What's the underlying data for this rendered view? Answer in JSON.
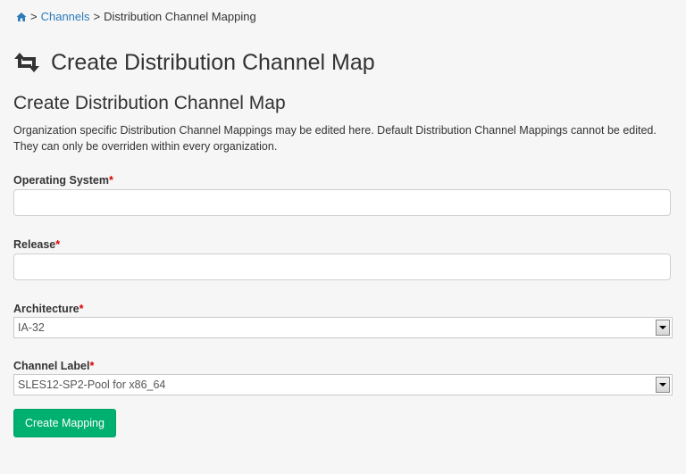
{
  "breadcrumb": {
    "home_icon": "home-icon",
    "sep1": ">",
    "channels": "Channels",
    "sep2": ">",
    "current": "Distribution Channel Mapping"
  },
  "header": {
    "icon": "retweet-icon",
    "title": "Create Distribution Channel Map"
  },
  "form": {
    "section_title": "Create Distribution Channel Map",
    "description": "Organization specific Distribution Channel Mappings may be edited here. Default Distribution Channel Mappings cannot be edited. They can only be overriden within every organization.",
    "required_marker": "*",
    "os": {
      "label": "Operating System",
      "value": ""
    },
    "release": {
      "label": "Release",
      "value": ""
    },
    "architecture": {
      "label": "Architecture",
      "value": "IA-32"
    },
    "channel": {
      "label": "Channel Label",
      "value": "SLES12-SP2-Pool for x86_64"
    },
    "submit_label": "Create Mapping"
  },
  "colors": {
    "link": "#2c7ab8",
    "button": "#00b070",
    "required": "#dd0000"
  }
}
